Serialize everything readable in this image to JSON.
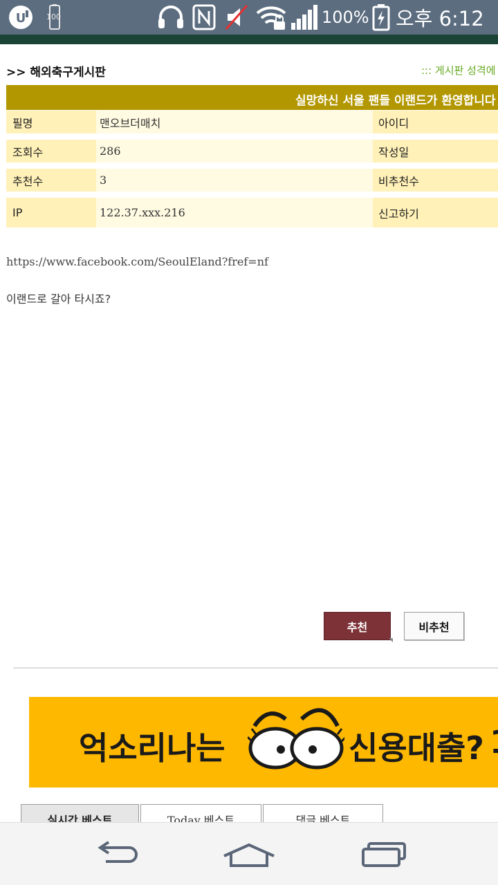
{
  "status_bar": {
    "carrier_icon": "uplus-logo-icon",
    "battery_badge": "100",
    "battery_percent": "100%",
    "time": "오후 6:12",
    "icons": [
      "headset-icon",
      "nfc-icon",
      "mute-icon",
      "wifi-lock-icon",
      "signal-icon",
      "battery-charging-icon"
    ]
  },
  "board": {
    "title": ">> 해외축구게시판",
    "link": "::: 게시판 성격에",
    "accent_color": "#b29700",
    "link_color": "#66aa22"
  },
  "post": {
    "title": "실망하신 서울 팬들 이랜드가 환영합니다",
    "rows": [
      {
        "label": "필명",
        "value": "맨오브더매치",
        "label2": "아이디"
      },
      {
        "label": "조회수",
        "value": "286",
        "label2": "작성일"
      },
      {
        "label": "추천수",
        "value": "3",
        "label2": "비추천수"
      },
      {
        "label": "IP",
        "value": "122.37.xxx.216",
        "label2": "신고하기"
      }
    ],
    "url": "https://www.facebook.com/SeoulEland?fref=nf",
    "body": "이랜드로 갈아 타시죠?"
  },
  "buttons": {
    "recommend": "추천",
    "not_recommend": "비추천",
    "recommend_color": "#7d3238"
  },
  "ad": {
    "text_left": "억소리나는",
    "text_right": "신용대출?",
    "text_cut": "1",
    "bg_color": "#ffb800"
  },
  "tabs": [
    {
      "label": "실시간 베스트",
      "active": true
    },
    {
      "label": "Today 베스트",
      "active": false
    },
    {
      "label": "댓글 베스트",
      "active": false
    }
  ],
  "nav": {
    "back_icon": "back-icon",
    "home_icon": "home-icon",
    "recents_icon": "recents-icon"
  }
}
